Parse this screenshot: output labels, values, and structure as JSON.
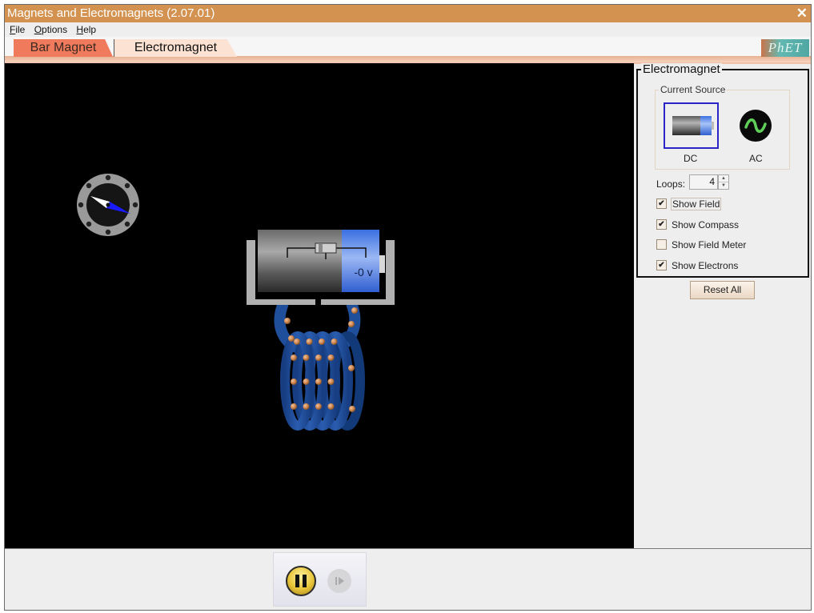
{
  "window": {
    "title": "Magnets and Electromagnets (2.07.01)",
    "close_glyph": "✕"
  },
  "menu": {
    "items": [
      {
        "label": "File",
        "mnemonic": "F"
      },
      {
        "label": "Options",
        "mnemonic": "O"
      },
      {
        "label": "Help",
        "mnemonic": "H"
      }
    ]
  },
  "tabs": [
    {
      "label": "Bar Magnet",
      "selected": false
    },
    {
      "label": "Electromagnet",
      "selected": true
    }
  ],
  "logo": {
    "text": "PhET"
  },
  "simulation": {
    "battery_voltage_label": "-0 v",
    "coil_loops": 4,
    "show_field": true,
    "show_compass": true,
    "show_electrons": true
  },
  "control_panel": {
    "group_title": "Electromagnet",
    "current_source": {
      "title": "Current Source",
      "options": [
        {
          "label": "DC",
          "icon": "battery-icon",
          "selected": true
        },
        {
          "label": "AC",
          "icon": "ac-sine-icon",
          "selected": false
        }
      ]
    },
    "loops": {
      "label": "Loops:",
      "value": "4",
      "up_glyph": "▲",
      "down_glyph": "▼"
    },
    "checkboxes": [
      {
        "label": "Show Field",
        "checked": true,
        "focused": true
      },
      {
        "label": "Show Compass",
        "checked": true,
        "focused": false
      },
      {
        "label": "Show Field Meter",
        "checked": false,
        "focused": false
      },
      {
        "label": "Show Electrons",
        "checked": true,
        "focused": false
      }
    ],
    "check_glyph": "✔",
    "reset_label": "Reset All"
  },
  "clock_controls": {
    "state": "playing",
    "pause_icon": "pause-icon",
    "step_icon": "step-icon"
  },
  "colors": {
    "titlebar": "#d49250",
    "tab_inactive": "#f07a5c",
    "tab_active": "#fbe2d2",
    "canvas_bg": "#000000",
    "coil": "#1f4f9a",
    "electron": "#c9814a",
    "battery_positive": "#3a6fe0",
    "selection_border": "#2b22c8",
    "ac_wave": "#5fcf5a"
  }
}
